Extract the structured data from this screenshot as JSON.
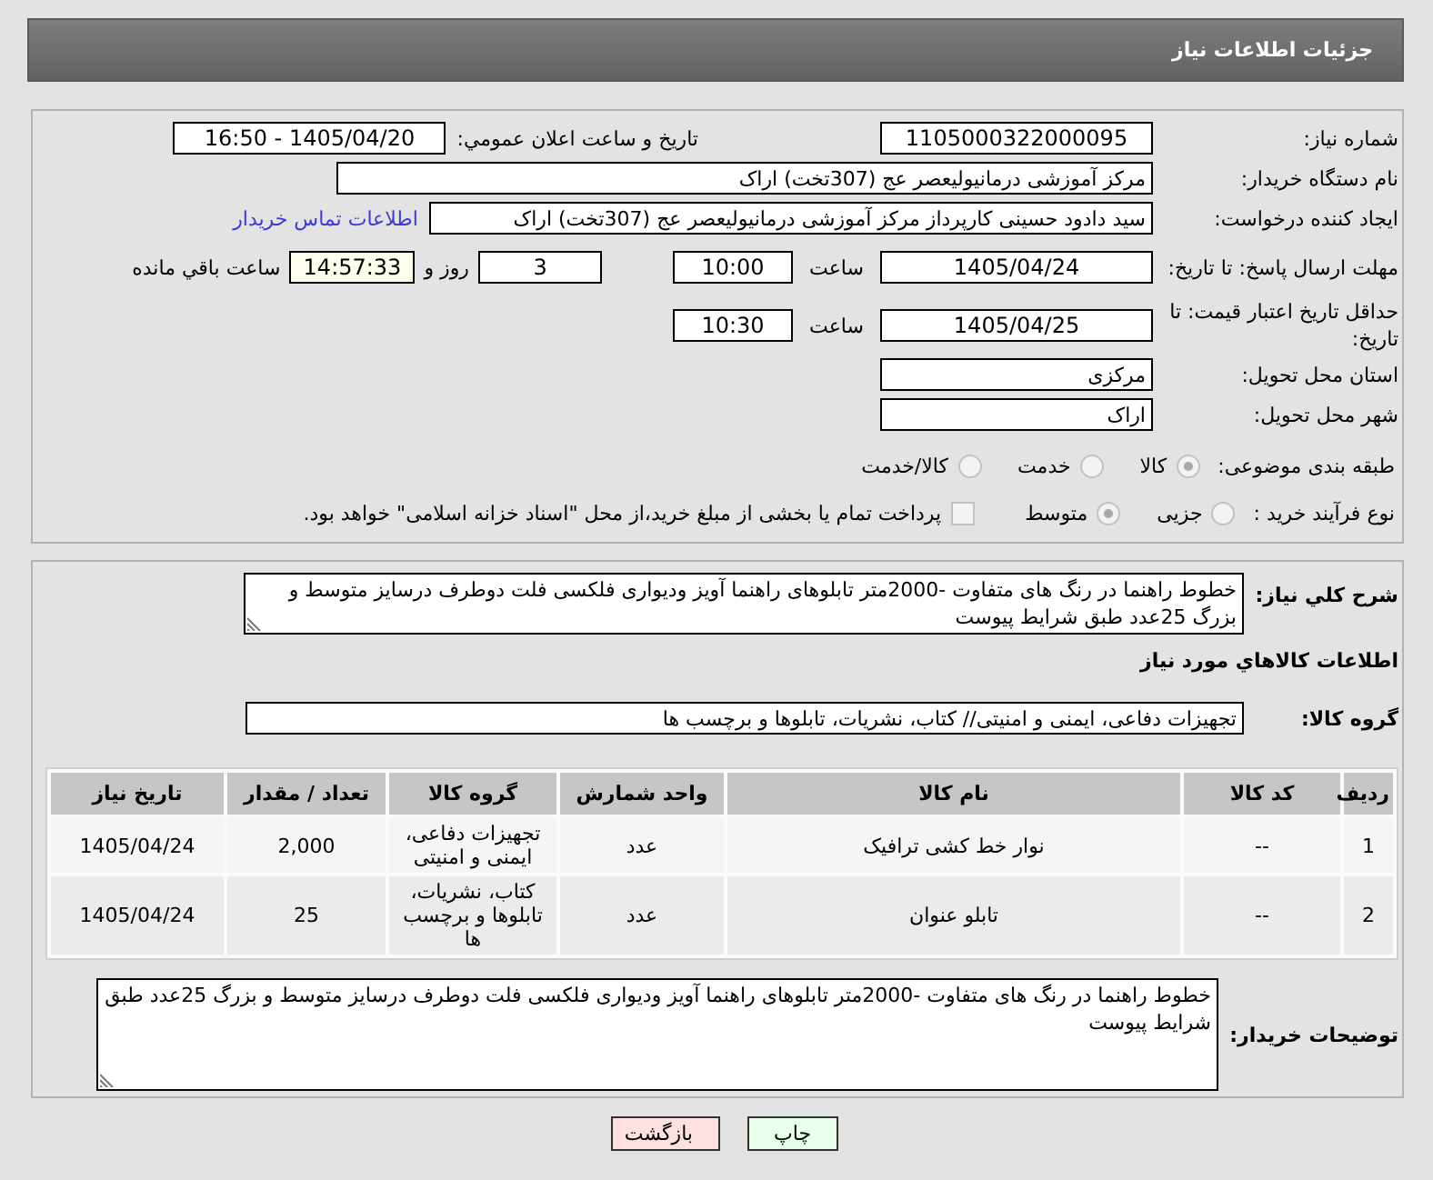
{
  "header": {
    "title": "جزئیات اطلاعات نیاز"
  },
  "details": {
    "need_number": {
      "label": "شماره نیاز:",
      "value": "1105000322000095"
    },
    "announcement": {
      "label": "تاریخ و ساعت اعلان عمومي:",
      "value": "1405/04/20 - 16:50"
    },
    "buyer": {
      "label": "نام دستگاه خریدار:",
      "value": "مرکز آموزشی درمانیولیعصر عج (307تخت) اراک"
    },
    "requester": {
      "label": "ایجاد کننده درخواست:",
      "value": "سید دادود حسینی کارپرداز مرکز آموزشی درمانیولیعصر عج (307تخت) اراک",
      "contact_link": "اطلاعات تماس خریدار"
    },
    "response_deadline": {
      "label": "مهلت ارسال پاسخ: تا تاریخ:",
      "date": "1405/04/24",
      "time_label": "ساعت",
      "time": "10:00",
      "days": "3",
      "days_label": "روز و",
      "remaining": "14:57:33",
      "remaining_label": "ساعت باقي مانده"
    },
    "price_validity": {
      "label": "حداقل تاریخ اعتبار قیمت: تا تاریخ:",
      "date": "1405/04/25",
      "time_label": "ساعت",
      "time": "10:30"
    },
    "province": {
      "label": "استان محل تحویل:",
      "value": "مرکزی"
    },
    "city": {
      "label": "شهر محل تحویل:",
      "value": "اراک"
    },
    "category": {
      "label": "طبقه بندی موضوعی:",
      "options": [
        {
          "label": "کالا",
          "selected": true,
          "disabled": true
        },
        {
          "label": "خدمت",
          "selected": false,
          "disabled": true
        },
        {
          "label": "کالا/خدمت",
          "selected": false,
          "disabled": true
        }
      ]
    },
    "purchase_process": {
      "label": "نوع فرآیند خرید :",
      "options": [
        {
          "label": "جزیی",
          "selected": false,
          "disabled": true
        },
        {
          "label": "متوسط",
          "selected": true,
          "disabled": true
        }
      ],
      "treasury_payment": {
        "label": "پرداخت تمام یا بخشی از مبلغ خرید،از محل \"اسناد خزانه اسلامی\" خواهد بود.",
        "checked": false,
        "disabled": true
      }
    }
  },
  "goods": {
    "description_label": "شرح كلي نياز:",
    "description": "خطوط راهنما در رنگ های متفاوت -2000متر تابلوهای راهنما آویز ودیواری فلکسی فلت دوطرف درسایز متوسط و بزرگ 25عدد طبق شرایط پیوست",
    "section_title": "اطلاعات كالاهاي مورد نياز",
    "group_label": "گروه كالا:",
    "group": "تجهیزات دفاعی، ایمنی و امنیتی// کتاب، نشریات، تابلوها و برچسب ها",
    "table": {
      "columns": [
        "ردیف",
        "کد کالا",
        "نام کالا",
        "واحد شمارش",
        "گروه کالا",
        "تعداد / مقدار",
        "تاریخ نیاز"
      ],
      "rows": [
        [
          "1",
          "--",
          "نوار خط کشی ترافیک",
          "عدد",
          "تجهیزات دفاعی، ایمنی و امنیتی",
          "2,000",
          "1405/04/24"
        ],
        [
          "2",
          "--",
          "تابلو عنوان",
          "عدد",
          "کتاب، نشریات، تابلوها و برچسب ها",
          "25",
          "1405/04/24"
        ]
      ]
    },
    "buyer_notes_label": "توضیحات خریدار:",
    "buyer_notes": "خطوط راهنما در رنگ های متفاوت -2000متر تابلوهای راهنما آویز ودیواری فلکسی فلت دوطرف درسایز متوسط و بزرگ 25عدد طبق شرایط پیوست"
  },
  "buttons": [
    {
      "label": "چاپ",
      "kind": "print"
    },
    {
      "label": "بازگشت",
      "kind": "back"
    }
  ]
}
